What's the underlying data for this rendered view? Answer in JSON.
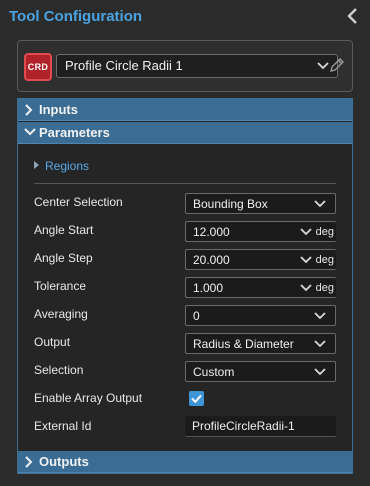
{
  "header": {
    "title": "Tool Configuration"
  },
  "tool": {
    "badge": "CRD",
    "name": "Profile Circle Radii 1"
  },
  "sections": {
    "inputs": "Inputs",
    "parameters": "Parameters",
    "outputs": "Outputs"
  },
  "regions": {
    "label": "Regions"
  },
  "parameters": {
    "center_selection": {
      "label": "Center Selection",
      "value": "Bounding Box"
    },
    "angle_start": {
      "label": "Angle Start",
      "value": "12.000",
      "unit": "deg"
    },
    "angle_step": {
      "label": "Angle Step",
      "value": "20.000",
      "unit": "deg"
    },
    "tolerance": {
      "label": "Tolerance",
      "value": "1.000",
      "unit": "deg"
    },
    "averaging": {
      "label": "Averaging",
      "value": "0"
    },
    "output": {
      "label": "Output",
      "value": "Radius & Diameter"
    },
    "selection": {
      "label": "Selection",
      "value": "Custom"
    },
    "enable_array_output": {
      "label": "Enable Array Output",
      "checked": true
    },
    "external_id": {
      "label": "External Id",
      "value": "ProfileCircleRadii-1"
    }
  },
  "colors": {
    "accent": "#4aa3e0",
    "section_header": "#3b6d94",
    "badge": "#b0232a",
    "checkbox": "#3d95d8"
  },
  "icons": {
    "collapse": "chevron-left-icon",
    "dropdown": "chevron-down-icon",
    "edit": "pencil-icon",
    "section_expand": "chevron-right-icon",
    "section_collapse": "chevron-down-icon",
    "regions": "triangle-right-icon",
    "check": "check-icon"
  }
}
